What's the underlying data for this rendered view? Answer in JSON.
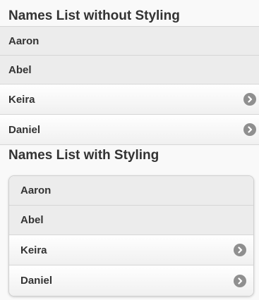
{
  "sections": [
    {
      "title": "Names List without Styling",
      "items": [
        {
          "label": "Aaron",
          "type": "static"
        },
        {
          "label": "Abel",
          "type": "static"
        },
        {
          "label": "Keira",
          "type": "link",
          "icon": "chevron-right-icon"
        },
        {
          "label": "Daniel",
          "type": "link",
          "icon": "chevron-right-icon"
        }
      ]
    },
    {
      "title": "Names List with Styling",
      "items": [
        {
          "label": "Aaron",
          "type": "static"
        },
        {
          "label": "Abel",
          "type": "static"
        },
        {
          "label": "Keira",
          "type": "link",
          "icon": "chevron-right-icon"
        },
        {
          "label": "Daniel",
          "type": "link",
          "icon": "chevron-right-icon"
        }
      ]
    }
  ],
  "colors": {
    "background": "#f9f9f9",
    "static_item": "#ececec",
    "link_item_top": "#ffffff",
    "link_item_bottom": "#f0f0f0",
    "divider": "#d6d6d6",
    "chevron_bg": "#8f8f8f",
    "text": "#333333"
  }
}
